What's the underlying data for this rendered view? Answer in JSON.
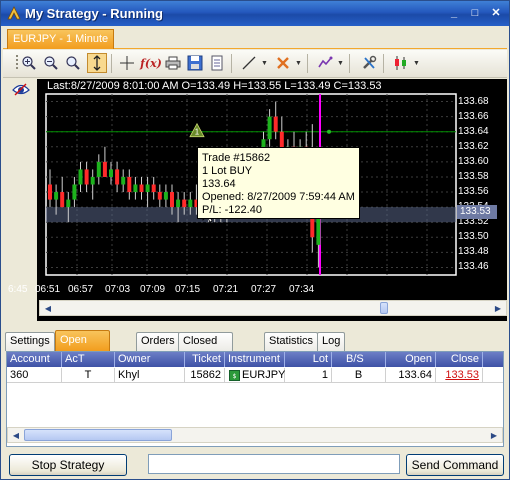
{
  "window": {
    "title": "My Strategy - Running",
    "minimize": "_",
    "maximize": "□",
    "close": "✕"
  },
  "chart_tab": {
    "label": "EURJPY - 1 Minute"
  },
  "toolbar": {
    "icons": [
      "zoom-in-icon",
      "zoom-out-icon",
      "zoom-reset-icon",
      "auto-scale-icon",
      "crosshair-icon",
      "indicators-icon",
      "print-icon",
      "save-icon",
      "properties-icon",
      "line-draw-icon",
      "marker-icon",
      "strategy-icon",
      "tools-icon",
      "bar-type-icon"
    ]
  },
  "chart": {
    "ohlc_line": "Last:8/27/2009 8:01:00 AM O=133.49 H=133.55 L=133.49 C=133.53",
    "current_price": "133.53",
    "price_labels": [
      "133.68",
      "133.66",
      "133.64",
      "133.62",
      "133.60",
      "133.58",
      "133.56",
      "133.54",
      "133.52",
      "133.50",
      "133.48",
      "133.46"
    ],
    "time_labels": [
      "6:45",
      "06:51",
      "06:57",
      "07:03",
      "07:09",
      "07:15",
      "07:21",
      "07:27",
      "07:34"
    ],
    "trade_marker": "1",
    "colors": {
      "up": "#1db21d",
      "down": "#ff2a2a",
      "cursor": "#ff00ff",
      "entry_line": "#009000",
      "background": "#000000"
    }
  },
  "tooltip": {
    "trade": "Trade #15862",
    "side": "1 Lot BUY",
    "price": "133.64",
    "opened": "Opened: 8/27/2009 7:59:44 AM",
    "pl": "P/L: -122.40"
  },
  "bottom_tabs": [
    "Settings",
    "Open Positions",
    "Orders",
    "Closed Positions",
    "Statistics",
    "Log"
  ],
  "active_tab": "Open Positions",
  "positions": {
    "headers": [
      "Account",
      "AcT",
      "Owner",
      "Ticket",
      "Instrument",
      "Lot",
      "B/S",
      "Open",
      "Close"
    ],
    "rows": [
      {
        "account": "360",
        "act": "T",
        "owner": "Khyl",
        "ticket": "15862",
        "instrument": "EURJPY",
        "lot": "1",
        "bs": "B",
        "open": "133.64",
        "close": "133.53"
      }
    ]
  },
  "footer": {
    "stop_button": "Stop Strategy",
    "command_value": "",
    "send_button": "Send Command"
  }
}
